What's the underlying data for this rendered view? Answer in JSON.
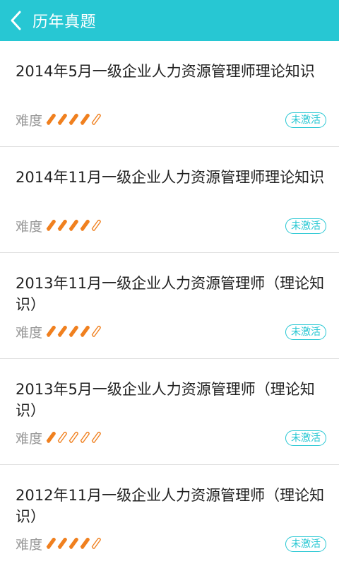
{
  "header": {
    "title": "历年真题",
    "back_icon": "chevron-left-icon"
  },
  "colors": {
    "accent": "#27c7d3",
    "pencil_filled": "#f0801f",
    "pencil_empty": "#f0801f"
  },
  "items": [
    {
      "title": "2014年5月一级企业人力资源管理师理论知识",
      "difficulty_label": "难度",
      "difficulty_level": 4,
      "difficulty_max": 5,
      "status": "未激活"
    },
    {
      "title": "2014年11月一级企业人力资源管理师理论知识",
      "difficulty_label": "难度",
      "difficulty_level": 4,
      "difficulty_max": 5,
      "status": "未激活"
    },
    {
      "title": "2013年11月一级企业人力资源管理师（理论知识）",
      "difficulty_label": "难度",
      "difficulty_level": 4,
      "difficulty_max": 5,
      "status": "未激活"
    },
    {
      "title": "2013年5月一级企业人力资源管理师（理论知识）",
      "difficulty_label": "难度",
      "difficulty_level": 1,
      "difficulty_max": 5,
      "status": "未激活"
    },
    {
      "title": "2012年11月一级企业人力资源管理师（理论知识）",
      "difficulty_label": "难度",
      "difficulty_level": 4,
      "difficulty_max": 5,
      "status": "未激活"
    }
  ]
}
